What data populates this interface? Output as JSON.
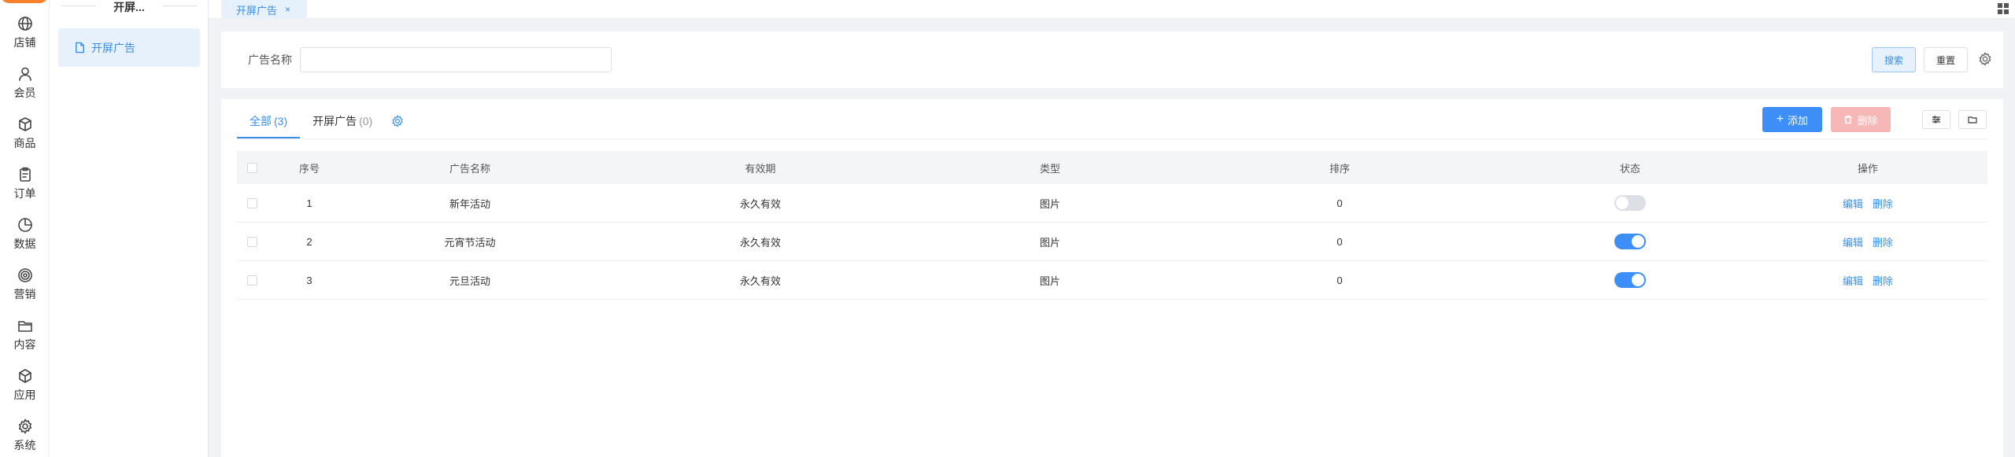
{
  "rail": {
    "items": [
      {
        "label": "店铺",
        "icon": "globe-icon"
      },
      {
        "label": "会员",
        "icon": "user-icon"
      },
      {
        "label": "商品",
        "icon": "box-icon"
      },
      {
        "label": "订单",
        "icon": "clipboard-icon"
      },
      {
        "label": "数据",
        "icon": "pie-chart-icon"
      },
      {
        "label": "营销",
        "icon": "target-icon"
      },
      {
        "label": "内容",
        "icon": "folder-icon"
      },
      {
        "label": "应用",
        "icon": "cube-icon"
      },
      {
        "label": "系统",
        "icon": "gear-icon"
      }
    ]
  },
  "submenu": {
    "title": "开屏...",
    "active_item": "开屏广告"
  },
  "tabbar": {
    "open_tab": "开屏广告",
    "close_glyph": "×"
  },
  "search": {
    "label": "广告名称",
    "value": "",
    "placeholder": "",
    "search_button": "搜索",
    "reset_button": "重置"
  },
  "list": {
    "tabs": [
      {
        "label": "全部",
        "count": "(3)",
        "active": true
      },
      {
        "label": "开屏广告",
        "count": "(0)",
        "active": false
      }
    ],
    "add_button": "添加",
    "add_glyph": "+",
    "delete_button": "删除",
    "columns": [
      "序号",
      "广告名称",
      "有效期",
      "类型",
      "排序",
      "状态",
      "操作"
    ],
    "rows": [
      {
        "index": "1",
        "name": "新年活动",
        "validity": "永久有效",
        "type": "图片",
        "sort": "0",
        "enabled": false
      },
      {
        "index": "2",
        "name": "元宵节活动",
        "validity": "永久有效",
        "type": "图片",
        "sort": "0",
        "enabled": true
      },
      {
        "index": "3",
        "name": "元旦活动",
        "validity": "永久有效",
        "type": "图片",
        "sort": "0",
        "enabled": true
      }
    ],
    "row_actions": {
      "edit": "编辑",
      "delete": "删除"
    }
  },
  "colors": {
    "primary": "#3e8ef7",
    "link": "#3a8ee6",
    "danger_disabled": "#f8b7b7",
    "brand_orange": "#f7812a"
  }
}
